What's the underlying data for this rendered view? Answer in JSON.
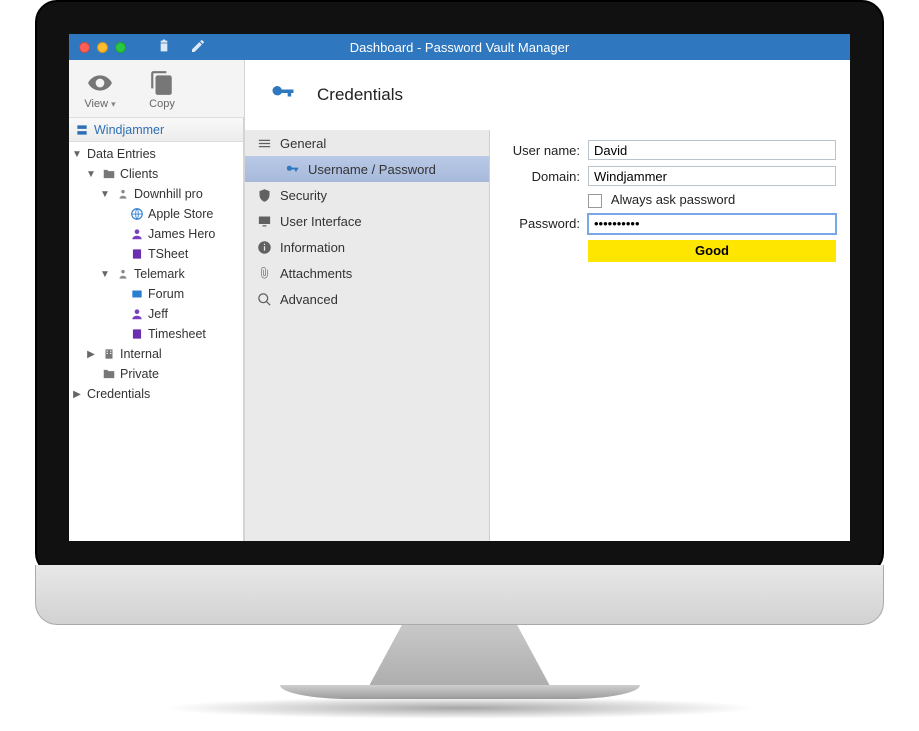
{
  "window": {
    "title": "Dashboard - Password Vault Manager"
  },
  "toolbar": {
    "view_label": "View",
    "copy_label": "Copy"
  },
  "sidebar": {
    "datasource": "Windjammer",
    "root_data_entries": "Data Entries",
    "clients": "Clients",
    "downhill": "Downhill pro",
    "apple_store": "Apple Store",
    "james_hero": "James Hero",
    "tsheet": "TSheet",
    "telemark": "Telemark",
    "forum": "Forum",
    "jeff": "Jeff",
    "timesheet": "Timesheet",
    "internal": "Internal",
    "private": "Private",
    "credentials": "Credentials"
  },
  "header": {
    "title": "Credentials"
  },
  "nav": {
    "general": "General",
    "username_password": "Username / Password",
    "security": "Security",
    "user_interface": "User Interface",
    "information": "Information",
    "attachments": "Attachments",
    "advanced": "Advanced"
  },
  "form": {
    "username_label": "User name:",
    "username_value": "David",
    "domain_label": "Domain:",
    "domain_value": "Windjammer",
    "always_ask": "Always ask password",
    "password_label": "Password:",
    "password_value": "••••••••••",
    "strength": "Good"
  }
}
